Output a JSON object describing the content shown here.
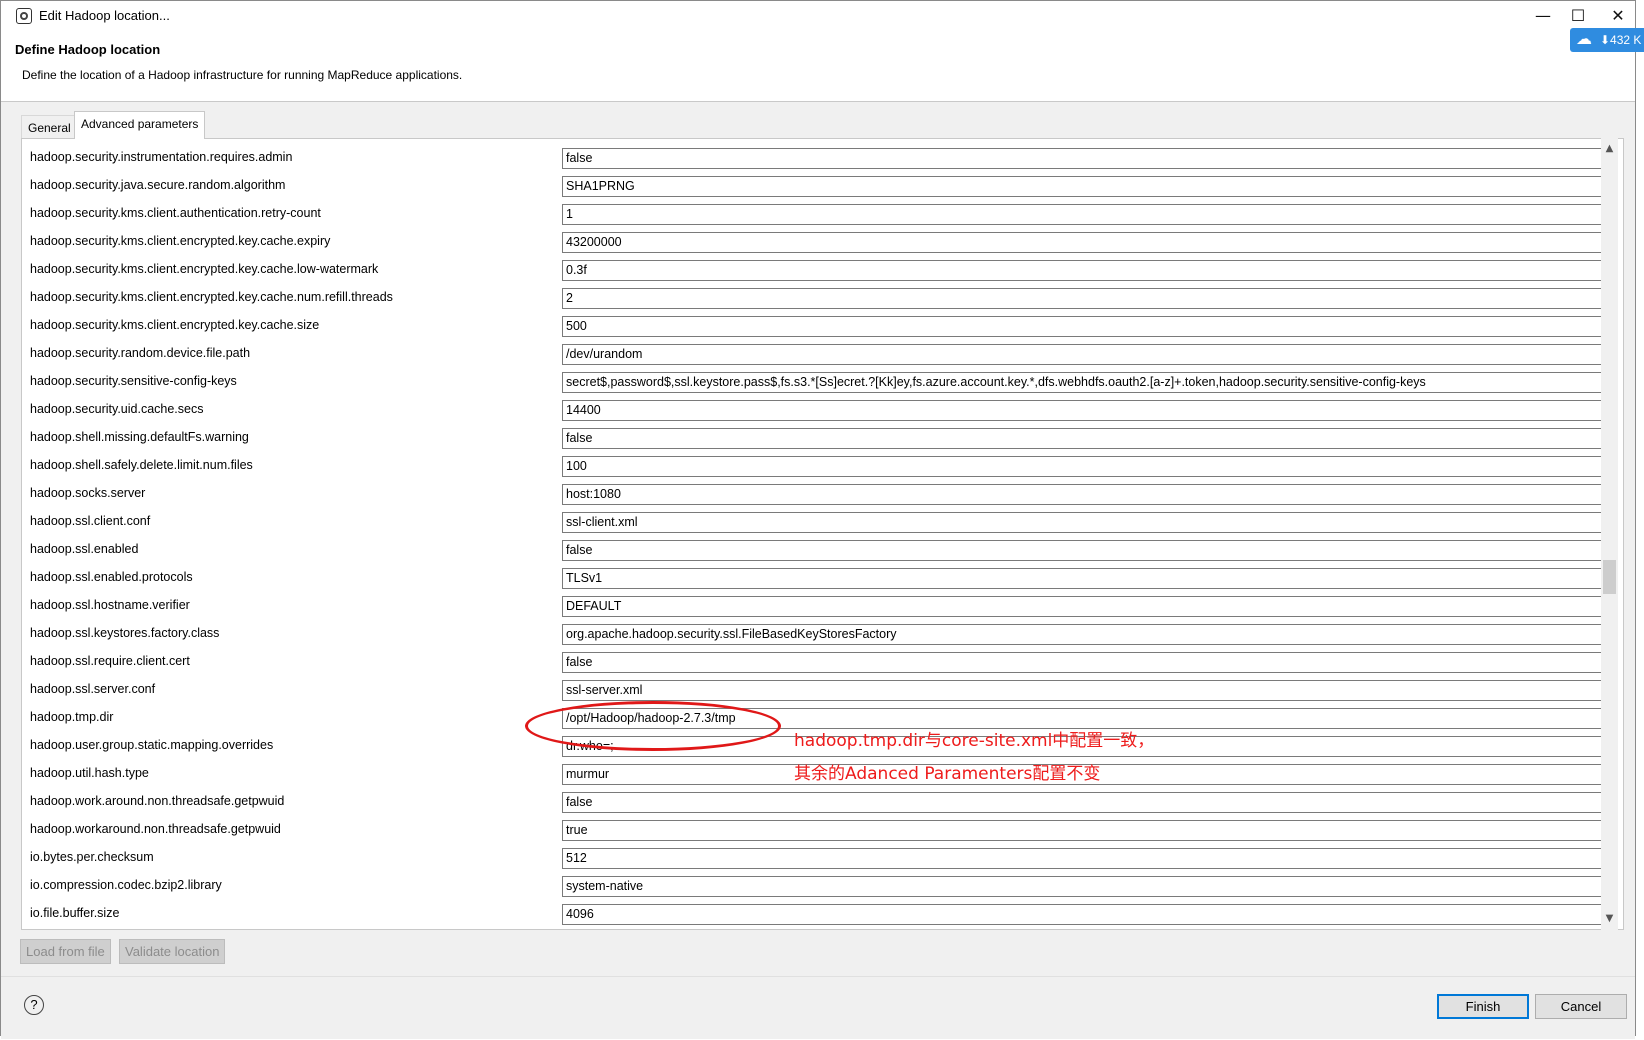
{
  "window": {
    "title": "Edit Hadoop location...",
    "minimize": "—",
    "maximize": "☐",
    "close": "✕"
  },
  "header": {
    "title": "Define Hadoop location",
    "description": "Define the location of a Hadoop infrastructure for running MapReduce applications."
  },
  "widget": {
    "icon": "cloud-icon",
    "count": "⬇432 K"
  },
  "tabs": [
    {
      "label": "General",
      "active": false
    },
    {
      "label": "Advanced parameters",
      "active": true
    }
  ],
  "params": [
    {
      "key": "hadoop.security.instrumentation.requires.admin",
      "value": "false"
    },
    {
      "key": "hadoop.security.java.secure.random.algorithm",
      "value": "SHA1PRNG"
    },
    {
      "key": "hadoop.security.kms.client.authentication.retry-count",
      "value": "1"
    },
    {
      "key": "hadoop.security.kms.client.encrypted.key.cache.expiry",
      "value": "43200000"
    },
    {
      "key": "hadoop.security.kms.client.encrypted.key.cache.low-watermark",
      "value": "0.3f"
    },
    {
      "key": "hadoop.security.kms.client.encrypted.key.cache.num.refill.threads",
      "value": "2"
    },
    {
      "key": "hadoop.security.kms.client.encrypted.key.cache.size",
      "value": "500"
    },
    {
      "key": "hadoop.security.random.device.file.path",
      "value": "/dev/urandom"
    },
    {
      "key": "hadoop.security.sensitive-config-keys",
      "value": "secret$,password$,ssl.keystore.pass$,fs.s3.*[Ss]ecret.?[Kk]ey,fs.azure.account.key.*,dfs.webhdfs.oauth2.[a-z]+.token,hadoop.security.sensitive-config-keys"
    },
    {
      "key": "hadoop.security.uid.cache.secs",
      "value": "14400"
    },
    {
      "key": "hadoop.shell.missing.defaultFs.warning",
      "value": "false"
    },
    {
      "key": "hadoop.shell.safely.delete.limit.num.files",
      "value": "100"
    },
    {
      "key": "hadoop.socks.server",
      "value": "host:1080"
    },
    {
      "key": "hadoop.ssl.client.conf",
      "value": "ssl-client.xml"
    },
    {
      "key": "hadoop.ssl.enabled",
      "value": "false"
    },
    {
      "key": "hadoop.ssl.enabled.protocols",
      "value": "TLSv1"
    },
    {
      "key": "hadoop.ssl.hostname.verifier",
      "value": "DEFAULT"
    },
    {
      "key": "hadoop.ssl.keystores.factory.class",
      "value": "org.apache.hadoop.security.ssl.FileBasedKeyStoresFactory"
    },
    {
      "key": "hadoop.ssl.require.client.cert",
      "value": "false"
    },
    {
      "key": "hadoop.ssl.server.conf",
      "value": "ssl-server.xml"
    },
    {
      "key": "hadoop.tmp.dir",
      "value": "/opt/Hadoop/hadoop-2.7.3/tmp"
    },
    {
      "key": "hadoop.user.group.static.mapping.overrides",
      "value": "dr.who=;"
    },
    {
      "key": "hadoop.util.hash.type",
      "value": "murmur"
    },
    {
      "key": "hadoop.work.around.non.threadsafe.getpwuid",
      "value": "false"
    },
    {
      "key": "hadoop.workaround.non.threadsafe.getpwuid",
      "value": "true"
    },
    {
      "key": "io.bytes.per.checksum",
      "value": "512"
    },
    {
      "key": "io.compression.codec.bzip2.library",
      "value": "system-native"
    },
    {
      "key": "io.file.buffer.size",
      "value": "4096"
    }
  ],
  "annotation": {
    "line1": "hadoop.tmp.dir与core-site.xml中配置一致，",
    "line2": "其余的Adanced Paramenters配置不变",
    "color": "#ee1b1b"
  },
  "actions": {
    "load_from_file": "Load from file",
    "validate_location": "Validate location"
  },
  "footer": {
    "help": "?",
    "finish": "Finish",
    "cancel": "Cancel"
  }
}
